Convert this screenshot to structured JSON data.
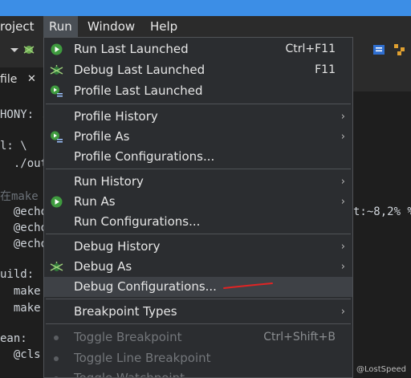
{
  "menubar": {
    "items": [
      "roject",
      "Run",
      "Window",
      "Help"
    ]
  },
  "tab": {
    "label": "file",
    "close": "✕"
  },
  "editor": {
    "lines": [
      {
        "text": "HONY: ."
      },
      {
        "text": "l: \\"
      },
      {
        "text": "  ./out"
      },
      {
        "text": "在make",
        "comment": true
      },
      {
        "text": "  @echo",
        "tail": "t:~8,2% %"
      },
      {
        "text": "  @echo"
      },
      {
        "text": "  @echo"
      },
      {
        "text": "uild:"
      },
      {
        "text": "  make"
      },
      {
        "text": "  make"
      },
      {
        "text": "ean:"
      },
      {
        "text": "  @cls"
      }
    ]
  },
  "run_menu": {
    "items": [
      {
        "label": "Run Last Launched",
        "accel": "Ctrl+F11",
        "icon": "run-icon"
      },
      {
        "label": "Debug Last Launched",
        "accel": "F11",
        "icon": "debug-icon"
      },
      {
        "label": "Profile Last Launched",
        "icon": "profile-icon"
      },
      {
        "label": "Profile History",
        "submenu": true
      },
      {
        "label": "Profile As",
        "submenu": true,
        "icon": "profile-icon"
      },
      {
        "label": "Profile Configurations..."
      },
      {
        "label": "Run History",
        "submenu": true
      },
      {
        "label": "Run As",
        "submenu": true,
        "icon": "run-icon"
      },
      {
        "label": "Run Configurations..."
      },
      {
        "label": "Debug History",
        "submenu": true
      },
      {
        "label": "Debug As",
        "submenu": true,
        "icon": "debug-icon"
      },
      {
        "label": "Debug Configurations...",
        "highlighted": true
      },
      {
        "label": "Breakpoint Types",
        "submenu": true
      },
      {
        "label": "Toggle Breakpoint",
        "accel": "Ctrl+Shift+B",
        "disabled": true
      },
      {
        "label": "Toggle Line Breakpoint",
        "disabled": true
      },
      {
        "label": "Toggle Watchpoint",
        "disabled": true
      }
    ],
    "submenu_arrow": "›"
  },
  "watermark": "CSDN @LostSpeed",
  "colors": {
    "titlebar": "#3c8ee6",
    "menu_bg": "#2b2d30",
    "hover": "#3e4146",
    "annotation": "#e02424"
  }
}
